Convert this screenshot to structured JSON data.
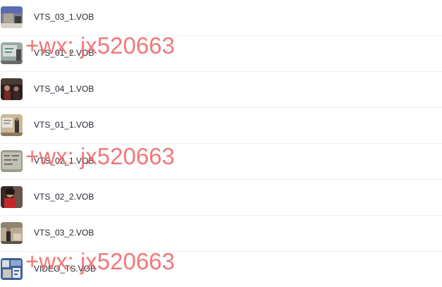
{
  "files": [
    {
      "name": "VTS_03_1.VOB",
      "thumbnail_icon": "video-thumbnail-icon"
    },
    {
      "name": "VTS_01_2.VOB",
      "thumbnail_icon": "video-thumbnail-icon"
    },
    {
      "name": "VTS_04_1.VOB",
      "thumbnail_icon": "video-thumbnail-icon"
    },
    {
      "name": "VTS_01_1.VOB",
      "thumbnail_icon": "video-thumbnail-icon"
    },
    {
      "name": "VTS_02_1.VOB",
      "thumbnail_icon": "video-thumbnail-icon"
    },
    {
      "name": "VTS_02_2.VOB",
      "thumbnail_icon": "video-thumbnail-icon"
    },
    {
      "name": "VTS_03_2.VOB",
      "thumbnail_icon": "video-thumbnail-icon"
    },
    {
      "name": "VIDEO_TS.VOB",
      "thumbnail_icon": "video-thumbnail-icon"
    }
  ],
  "watermarks": [
    "+wx: jx520663",
    "+wx: jx520663",
    "+wx: jx520663"
  ],
  "colors": {
    "watermark": "#ee6062",
    "text": "#1f2430",
    "divider": "#f1f1f3"
  }
}
